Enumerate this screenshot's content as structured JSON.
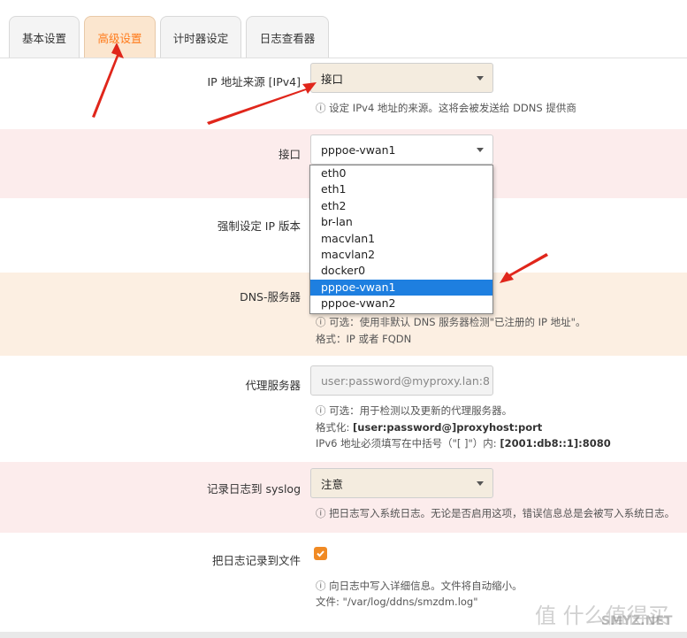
{
  "tabs": [
    {
      "label": "基本设置"
    },
    {
      "label": "高级设置"
    },
    {
      "label": "计时器设定"
    },
    {
      "label": "日志查看器"
    }
  ],
  "ip_source": {
    "label": "IP 地址来源 [IPv4]",
    "value": "接口",
    "help": "设定 IPv4 地址的来源。这将会被发送给 DDNS 提供商"
  },
  "interface": {
    "label": "接口",
    "value": "pppoe-vwan1",
    "options": [
      "eth0",
      "eth1",
      "eth2",
      "br-lan",
      "macvlan1",
      "macvlan2",
      "docker0",
      "pppoe-vwan1",
      "pppoe-vwan2"
    ],
    "selected_index": 7
  },
  "force_ip": {
    "label": "强制设定 IP 版本"
  },
  "dns_server": {
    "label": "DNS-服务器",
    "help1": "可选：使用非默认 DNS 服务器检测\"已注册的 IP 地址\"。",
    "help2": "格式：IP 或者 FQDN"
  },
  "proxy": {
    "label": "代理服务器",
    "placeholder": "user:password@myproxy.lan:8",
    "help1": "可选：用于检测以及更新的代理服务器。",
    "help2_prefix": "格式化: ",
    "help2_code": "[user:password@]proxyhost:port",
    "help3_prefix": "IPv6 地址必须填写在中括号（\"[ ]\"）内: ",
    "help3_code": "[2001:db8::1]:8080"
  },
  "syslog": {
    "label": "记录日志到 syslog",
    "value": "注意",
    "help": "把日志写入系统日志。无论是否启用这项，错误信息总是会被写入系统日志。"
  },
  "logfile": {
    "label": "把日志记录到文件",
    "checked": true,
    "help1": "向日志中写入详细信息。文件将自动缩小。",
    "help2": "文件: \"/var/log/ddns/smzdm.log\""
  },
  "watermark": {
    "text": "值 什么值得买",
    "brand": "SMYZ.NET"
  },
  "colors": {
    "accent": "#ff7a1a",
    "arrow": "#e0261b",
    "selected": "#1e7fe0",
    "row_pink": "#fcecec",
    "row_peach": "#fcefe2"
  }
}
